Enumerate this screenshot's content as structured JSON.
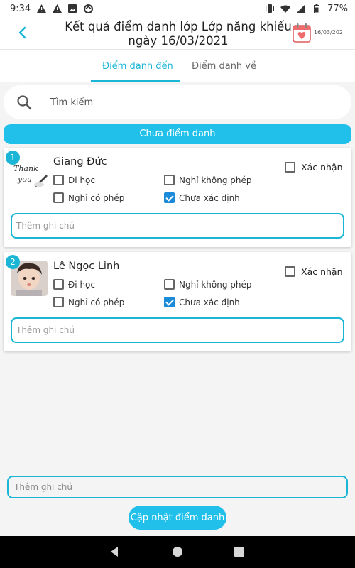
{
  "status_bar": {
    "time": "9:34",
    "battery": "77%"
  },
  "header": {
    "title": "Kết quả điểm danh lớp Lớp năng khiếu ngày 16/03/2021",
    "calendar_date": "16/03/202"
  },
  "tabs": [
    {
      "label": "Điểm danh đến"
    },
    {
      "label": "Điểm danh về"
    }
  ],
  "search": {
    "placeholder": "Tìm kiếm"
  },
  "section": {
    "label": "Chưa điểm danh"
  },
  "students": [
    {
      "index": "1",
      "name": "Giang Đức",
      "avatar_text": "Thank you",
      "options": {
        "present": "Đi học",
        "unexcused": "Nghỉ không phép",
        "excused": "Nghỉ có phép",
        "undetermined": "Chưa xác định"
      },
      "selected": "undetermined",
      "confirm_label": "Xác nhận",
      "note_placeholder": "Thêm ghi chú"
    },
    {
      "index": "2",
      "name": "Lê Ngọc Linh",
      "options": {
        "present": "Đi học",
        "unexcused": "Nghỉ không phép",
        "excused": "Nghỉ có phép",
        "undetermined": "Chưa xác định"
      },
      "selected": "undetermined",
      "confirm_label": "Xác nhận",
      "note_placeholder": "Thêm ghi chú"
    }
  ],
  "footer": {
    "note_placeholder": "Thêm ghi chú",
    "update_label": "Cập nhật điểm danh"
  },
  "colors": {
    "accent": "#1bb6d6",
    "button": "#20c0ea",
    "checkbox": "#1b8ad8"
  }
}
